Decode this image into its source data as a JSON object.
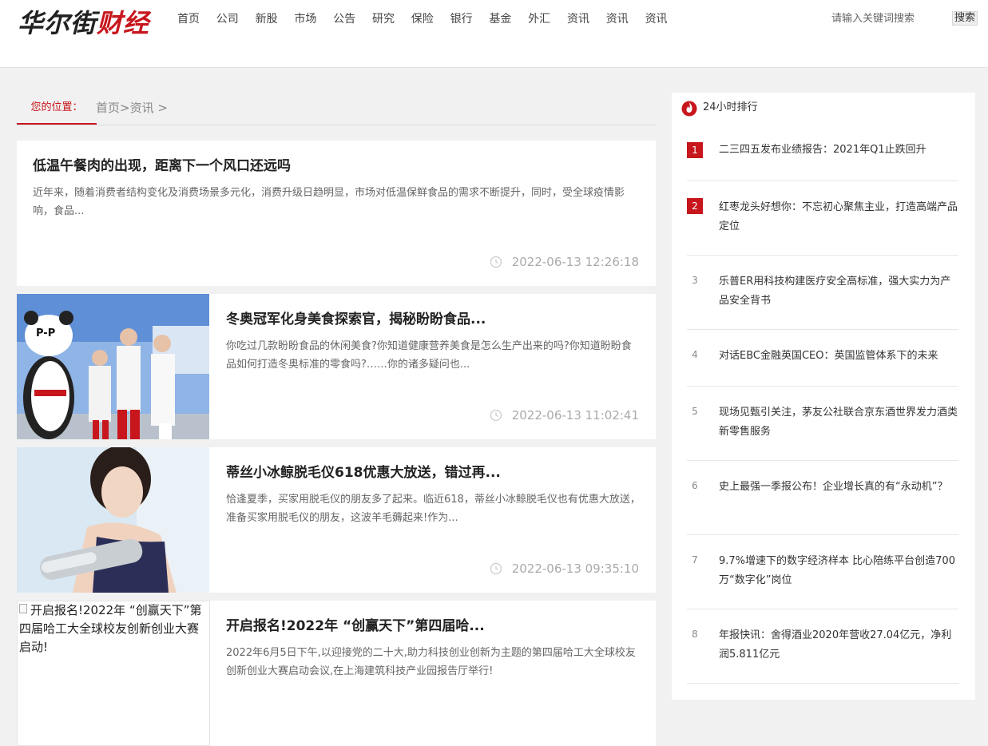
{
  "header": {
    "logo_part1": "华尔街",
    "logo_part2": "财经",
    "nav": [
      "首页",
      "公司",
      "新股",
      "市场",
      "公告",
      "研究",
      "保险",
      "银行",
      "基金",
      "外汇",
      "资讯",
      "资讯",
      "资讯"
    ],
    "search_placeholder": "请输入关键词搜索",
    "search_button": "搜索"
  },
  "breadcrumb": {
    "label": "您的位置：",
    "path": "首页>资讯 >"
  },
  "articles": [
    {
      "title": "低温午餐肉的出现，距离下一个风口还远吗",
      "summary": "近年来，随着消费者结构变化及消费场景多元化，消费升级日趋明显，市场对低温保鲜食品的需求不断提升，同时，受全球疫情影响，食品...",
      "time": "2022-06-13 12:26:18"
    },
    {
      "title": "冬奥冠军化身美食探索官，揭秘盼盼食品...",
      "summary": "你吃过几款盼盼食品的休闲美食?你知道健康营养美食是怎么生产出来的吗?你知道盼盼食品如何打造冬奥标准的零食吗?……你的诸多疑问也...",
      "time": "2022-06-13 11:02:41",
      "image_text": "P-P"
    },
    {
      "title": "蒂丝小冰鲸脱毛仪618优惠大放送，错过再...",
      "summary": "恰逢夏季，买家用脱毛仪的朋友多了起来。临近618，蒂丝小冰鲸脱毛仪也有优惠大放送，准备买家用脱毛仪的朋友，这波羊毛薅起来!作为...",
      "time": "2022-06-13 09:35:10"
    },
    {
      "title": "开启报名!2022年 “创赢天下”第四届哈...",
      "summary": "2022年6月5日下午,以迎接党的二十大,助力科技创业创新为主题的第四届哈工大全球校友创新创业大赛启动会议,在上海建筑科技产业园报告厅举行!",
      "image_alt": "开启报名!2022年 “创赢天下”第四届哈工大全球校友创新创业大赛启动!"
    }
  ],
  "sidebar": {
    "title": "24小时排行",
    "items": [
      {
        "rank": "1",
        "text": "二三四五发布业绩报告：2021年Q1止跌回升"
      },
      {
        "rank": "2",
        "text": "红枣龙头好想你：不忘初心聚焦主业，打造高端产品定位"
      },
      {
        "rank": "3",
        "text": "乐普ER用科技构建医疗安全高标准，强大实力为产品安全背书"
      },
      {
        "rank": "4",
        "text": "对话EBC金融英国CEO：英国监管体系下的未来"
      },
      {
        "rank": "5",
        "text": "现场见甄引关注，茅友公社联合京东酒世界发力酒类新零售服务"
      },
      {
        "rank": "6",
        "text": "史上最强一季报公布！企业增长真的有“永动机”？"
      },
      {
        "rank": "7",
        "text": "9.7%增速下的数字经济样本 比心陪练平台创造700万“数字化”岗位"
      },
      {
        "rank": "8",
        "text": "年报快讯：舍得酒业2020年营收27.04亿元，净利润5.811亿元"
      }
    ]
  },
  "colors": {
    "accent": "#c8161d",
    "background": "#f1f1f1"
  }
}
